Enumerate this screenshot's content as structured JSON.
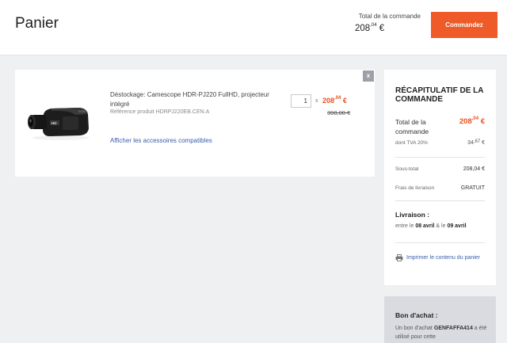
{
  "header": {
    "title": "Panier",
    "total_label": "Total de la commande",
    "total_whole": "208",
    "total_cents": ",04",
    "total_currency": "€",
    "order_button": "Commandez"
  },
  "cart": {
    "remove_label": "x",
    "item": {
      "name": "Déstockage: Camescope HDR-PJ220 FullHD, projecteur intégré",
      "reference": "Référence produit HDRPJ220EB.CEN.A",
      "accessories_link": "Afficher les accessoires compatibles",
      "quantity": "1",
      "times": "x",
      "price_whole": "208",
      "price_cents": ",04",
      "price_currency": "€",
      "old_price": "398,00 €"
    }
  },
  "summary": {
    "title": "RÉCAPITULATIF DE LA COMMANDE",
    "total_label": "Total de la commande",
    "total_whole": "208",
    "total_cents": ",04",
    "total_currency": "€",
    "tva_label": "dont TVA 20%",
    "tva_whole": "34",
    "tva_cents": ",67",
    "tva_currency": "€",
    "subtotal_label": "Sous-total",
    "subtotal_value": "208,04 €",
    "shipping_label": "Frais de livraison",
    "shipping_value": "GRATUIT",
    "delivery_title": "Livraison :",
    "delivery_prefix": "entre le",
    "delivery_from": "08 avril",
    "delivery_mid": "&",
    "delivery_le": "le",
    "delivery_to": "09 avril",
    "print_link": "Imprimer le contenu du panier"
  },
  "voucher": {
    "title": "Bon d'achat :",
    "text_prefix": "Un bon d'achat",
    "code": "GENFAFFA414",
    "text_suffix": "a été utilisé pour cette"
  },
  "colors": {
    "accent": "#ee5a28",
    "price": "#e8501e",
    "link": "#3b5ea8"
  }
}
